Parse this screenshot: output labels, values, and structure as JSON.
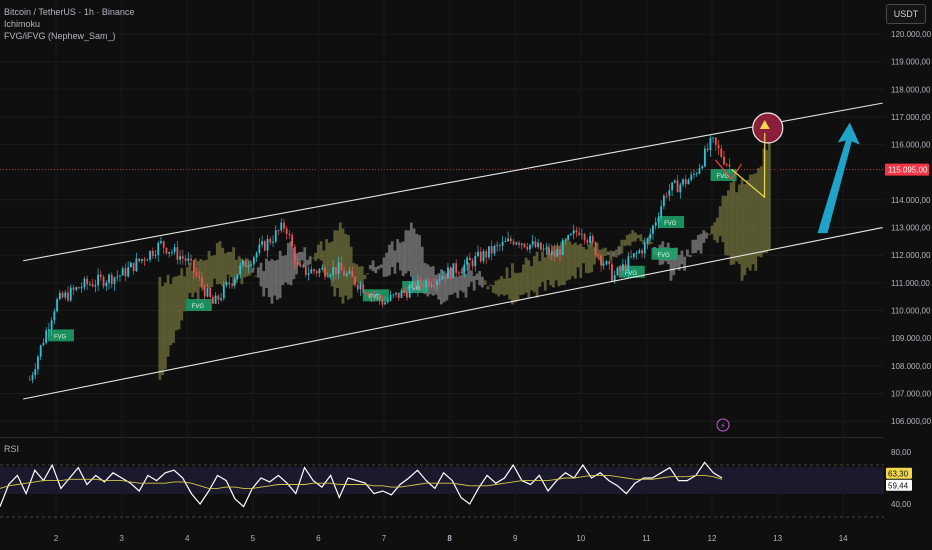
{
  "header": {
    "symbol_line": "Bitcoin / TetherUS · 1h · Binance",
    "indicator_1": "Ichimoku",
    "indicator_2": "FVG/iFVG (Nephew_Sam_)"
  },
  "currency_button": "USDT",
  "colors": {
    "background": "#0f0f0f",
    "up_candle": "#26c6da",
    "down_candle": "#ef5350",
    "current_price": "#f23645",
    "rsi_line": "#ffffff",
    "rsi_ma": "#d4c84a",
    "fvg_box": "#1fa36b",
    "cloud_bull": "#6b6b3a",
    "cloud_bear": "#7a7a7a",
    "target_circle": "#8b1e3a",
    "projection_arrow": "#1fa3c9"
  },
  "chart_data": [
    {
      "type": "candlestick",
      "title": "Bitcoin / TetherUS · 1h · Binance",
      "y_axis_unit": "USDT",
      "ylim": [
        105500,
        121000
      ],
      "y_ticks": [
        "120.000,00",
        "119.000,00",
        "118.000,00",
        "117.000,00",
        "116.000,00",
        "114.000,00",
        "113.000,00",
        "112.000,00",
        "111.000,00",
        "110.000,00",
        "109.000,00",
        "108.000,00",
        "107.000,00",
        "106.000,00"
      ],
      "x_ticks": [
        "2",
        "3",
        "4",
        "5",
        "6",
        "7",
        "8",
        "9",
        "10",
        "11",
        "12",
        "13",
        "14"
      ],
      "current_price_label": "115.095,00",
      "current_price": 115095,
      "price_path_day_close": [
        {
          "day": 1.6,
          "price": 107500
        },
        {
          "day": 2.0,
          "price": 110300
        },
        {
          "day": 2.4,
          "price": 110900
        },
        {
          "day": 3.0,
          "price": 111300
        },
        {
          "day": 3.6,
          "price": 112400
        },
        {
          "day": 4.0,
          "price": 111800
        },
        {
          "day": 4.4,
          "price": 110200
        },
        {
          "day": 4.8,
          "price": 111500
        },
        {
          "day": 5.5,
          "price": 113100
        },
        {
          "day": 5.7,
          "price": 111400
        },
        {
          "day": 6.3,
          "price": 111500
        },
        {
          "day": 7.0,
          "price": 110300
        },
        {
          "day": 7.6,
          "price": 111000
        },
        {
          "day": 8.2,
          "price": 111600
        },
        {
          "day": 9.0,
          "price": 112600
        },
        {
          "day": 9.6,
          "price": 112000
        },
        {
          "day": 10.0,
          "price": 113000
        },
        {
          "day": 10.5,
          "price": 111200
        },
        {
          "day": 11.0,
          "price": 112400
        },
        {
          "day": 11.3,
          "price": 114300
        },
        {
          "day": 11.7,
          "price": 114800
        },
        {
          "day": 12.0,
          "price": 116100
        },
        {
          "day": 12.3,
          "price": 115100
        }
      ],
      "channel": {
        "upper": [
          {
            "day": 1.5,
            "price": 111800
          },
          {
            "day": 14.6,
            "price": 117500
          }
        ],
        "lower": [
          {
            "day": 1.5,
            "price": 106800
          },
          {
            "day": 14.6,
            "price": 113000
          }
        ]
      },
      "fvg_labels": [
        "FVG",
        "FVG",
        "FVG",
        "FVG",
        "FVG",
        "FVG",
        "FVG",
        "FVG"
      ],
      "annotations": {
        "target_zone": {
          "day": 12.85,
          "price": 116600
        },
        "projection_arrow": {
          "from": {
            "day": 13.7,
            "price": 112800
          },
          "to": {
            "day": 14.1,
            "price": 116800
          }
        }
      }
    },
    {
      "type": "line",
      "title": "RSI",
      "ylim": [
        30,
        85
      ],
      "y_ticks": [
        "80,00",
        "40,00"
      ],
      "overbought": 70,
      "oversold": 30,
      "last_rsi_label": "63,30",
      "last_ma_label": "59,44",
      "series": [
        {
          "name": "RSI",
          "values": [
            38,
            55,
            62,
            48,
            66,
            58,
            70,
            52,
            60,
            68,
            55,
            62,
            57,
            64,
            60,
            56,
            50,
            62,
            58,
            64,
            66,
            60,
            48,
            40,
            50,
            62,
            58,
            44,
            38,
            52,
            60,
            57,
            62,
            56,
            48,
            68,
            58,
            53,
            62,
            45,
            60,
            58,
            56,
            48,
            50,
            47,
            55,
            60,
            66,
            58,
            52,
            64,
            58,
            45,
            40,
            52,
            62,
            56,
            60,
            70,
            58,
            55,
            62,
            50,
            58,
            64,
            60,
            70,
            60,
            64,
            58,
            54,
            48,
            56,
            60,
            60,
            64,
            68,
            58,
            58,
            62,
            72,
            64,
            60
          ]
        },
        {
          "name": "MA",
          "values": [
            52,
            54,
            55,
            56,
            57,
            58,
            58,
            58,
            59,
            59,
            59,
            59,
            58,
            58,
            58,
            57,
            56,
            56,
            56,
            56,
            57,
            57,
            56,
            54,
            52,
            52,
            53,
            53,
            52,
            52,
            53,
            54,
            55,
            55,
            55,
            55,
            56,
            56,
            56,
            55,
            55,
            55,
            55,
            54,
            54,
            53,
            53,
            54,
            55,
            56,
            56,
            56,
            56,
            55,
            54,
            54,
            54,
            55,
            56,
            57,
            58,
            58,
            58,
            58,
            59,
            60,
            60,
            61,
            62,
            62,
            62,
            61,
            60,
            59,
            59,
            59,
            60,
            61,
            61,
            61,
            62,
            62,
            61,
            59
          ]
        }
      ]
    }
  ]
}
